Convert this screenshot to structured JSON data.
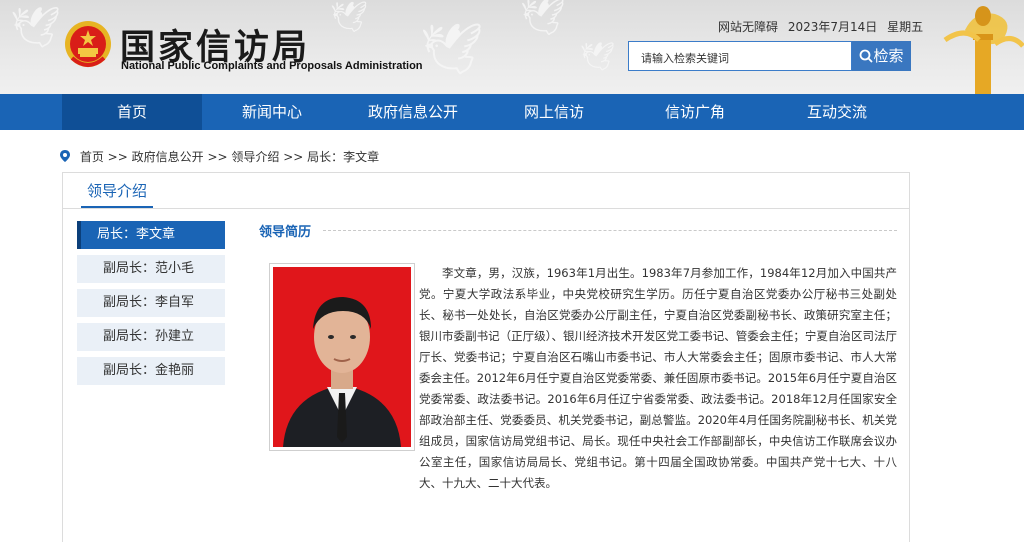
{
  "header": {
    "site_name_cn": "国家信访局",
    "site_name_en": "National Public Complaints and Proposals Administration",
    "accessibility_link": "网站无障碍",
    "date": "2023年7月14日",
    "weekday": "星期五",
    "search": {
      "placeholder": "请输入检索关键词",
      "button_label": "检索"
    }
  },
  "nav": {
    "items": [
      {
        "label": "首页",
        "active": true
      },
      {
        "label": "新闻中心"
      },
      {
        "label": "政府信息公开"
      },
      {
        "label": "网上信访"
      },
      {
        "label": "信访广角"
      },
      {
        "label": "互动交流"
      }
    ]
  },
  "breadcrumb": {
    "items": [
      "首页",
      "政府信息公开",
      "领导介绍",
      "局长：李文章"
    ],
    "separator": ">>"
  },
  "section": {
    "title": "领导介绍",
    "sidebar": [
      {
        "label": "局长：李文章",
        "active": true
      },
      {
        "label": "副局长：范小毛"
      },
      {
        "label": "副局长：李自军"
      },
      {
        "label": "副局长：孙建立"
      },
      {
        "label": "副局长：金艳丽"
      }
    ],
    "content_title": "领导简历",
    "bio": "李文章，男，汉族，1963年1月出生。1983年7月参加工作，1984年12月加入中国共产党。宁夏大学政法系毕业，中央党校研究生学历。历任宁夏自治区党委办公厅秘书三处副处长、秘书一处处长，自治区党委办公厅副主任，宁夏自治区党委副秘书长、政策研究室主任；银川市委副书记（正厅级）、银川经济技术开发区党工委书记、管委会主任；宁夏自治区司法厅厅长、党委书记；宁夏自治区石嘴山市委书记、市人大常委会主任；固原市委书记、市人大常委会主任。2012年6月任宁夏自治区党委常委、兼任固原市委书记。2015年6月任宁夏自治区党委常委、政法委书记。2016年6月任辽宁省委常委、政法委书记。2018年12月任国家安全部政治部主任、党委委员、机关党委书记，副总警监。2020年4月任国务院副秘书长、机关党组成员，国家信访局党组书记、局长。现任中央社会工作部副部长，中央信访工作联席会议办公室主任，国家信访局局长、党组书记。第十四届全国政协常委。中国共产党十七大、十八大、十九大、二十大代表。"
  },
  "colors": {
    "nav_blue": "#1a64b5",
    "nav_active": "#0f4f96",
    "sidebar_bg": "#eaf0f7",
    "photo_red": "#e0161b"
  }
}
